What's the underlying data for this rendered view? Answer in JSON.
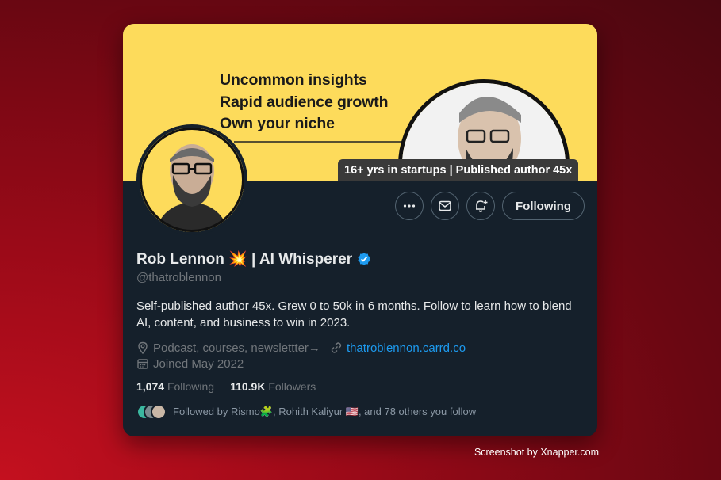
{
  "banner": {
    "lines": [
      "Uncommon insights",
      "Rapid audience growth",
      "Own your niche"
    ],
    "tag": "16+ yrs in startups | Published author 45x"
  },
  "profile": {
    "name": "Rob Lennon 💥 | AI Whisperer",
    "handle": "@thatroblennon",
    "bio": "Self-published author 45x. Grew 0 to 50k in 6 months. Follow to learn how to blend AI, content, and business to win in 2023.",
    "location": "Podcast, courses, newslettter→",
    "website": "thatroblennon.carrd.co",
    "joined": "Joined May 2022"
  },
  "actions": {
    "follow_label": "Following"
  },
  "stats": {
    "following_count": "1,074",
    "following_label": "Following",
    "followers_count": "110.9K",
    "followers_label": "Followers"
  },
  "followed_by": "Followed by Rismo🧩, Rohith Kaliyur 🇺🇸, and 78 others you follow",
  "credit": "Screenshot by Xnapper.com",
  "colors": {
    "banner": "#fddb5b",
    "card": "#15202b",
    "link": "#1d9bf0",
    "verified": "#1d9bf0"
  }
}
